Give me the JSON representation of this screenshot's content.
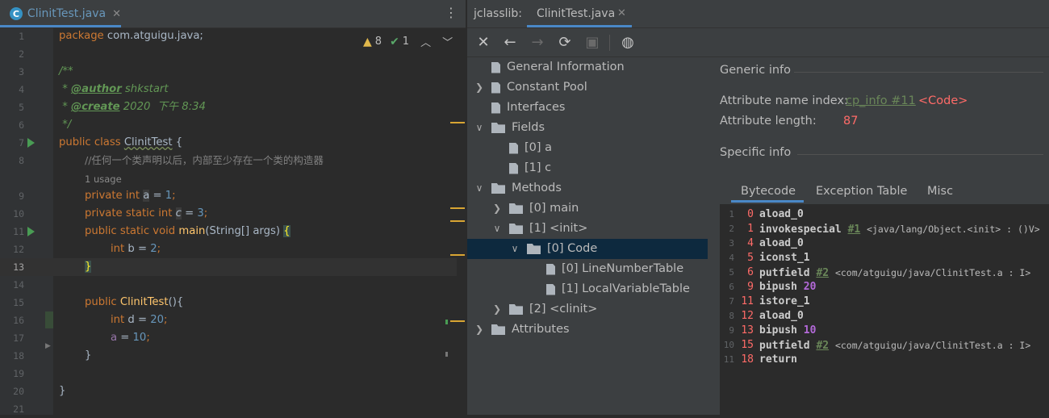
{
  "editor": {
    "tab_label": "ClinitTest.java",
    "tab_icon_letter": "C",
    "warnings_count": "8",
    "ok_count": "1",
    "line_numbers": [
      "1",
      "2",
      "3",
      "4",
      "5",
      "6",
      "7",
      "8",
      "9",
      "10",
      "11",
      "12",
      "13",
      "14",
      "15",
      "16",
      "17",
      "18",
      "19",
      "20",
      "21"
    ],
    "code": {
      "l1_pkg": "package",
      "l1_rest": " com.atguigu.java;",
      "l3": "/**",
      "l4_star": " * ",
      "l4_tag": "@author",
      "l4_val": " shkstart",
      "l5_star": " * ",
      "l5_tag": "@create",
      "l5_val": " 2020  下午 8:34",
      "l6": " */",
      "l7_kw": "public class",
      "l7_name": "ClinitTest",
      "l7_brace": " {",
      "l8": "//任何一个类声明以后，内部至少存在一个类的构造器",
      "usage": "1 usage",
      "l9_kw": "private int",
      "l9_var": "a",
      "l9_eq": " = ",
      "l9_val": "1",
      "l10_kw": "private static int",
      "l10_var": "c",
      "l10_eq": " = ",
      "l10_val": "3",
      "l11_kw": "public static void",
      "l11_fn": "main",
      "l11_args": "(String[] args) ",
      "l11_brace": "{",
      "l12_kw": "int",
      "l12_rest": " b = ",
      "l12_val": "2",
      "l13_brace": "}",
      "l15_kw": "public",
      "l15_fn": "ClinitTest",
      "l15_rest": "(){",
      "l16_kw": "int",
      "l16_rest": " d = ",
      "l16_val": "20",
      "l17_fld": "a",
      "l17_rest": " = ",
      "l17_val": "10",
      "l18": "}",
      "l20": "}",
      "semi": ";"
    }
  },
  "jclasslib": {
    "title": "jclasslib:",
    "tab_label": "ClinitTest.java",
    "toolbar": [
      "close-icon",
      "back-arrow-icon",
      "forward-arrow-icon",
      "refresh-icon",
      "save-icon",
      "web-icon"
    ],
    "tree": {
      "general": "General Information",
      "constant_pool": "Constant Pool",
      "interfaces": "Interfaces",
      "fields": "Fields",
      "field_a": "[0] a",
      "field_c": "[1] c",
      "methods": "Methods",
      "method_main": "[0] main",
      "method_init": "[1] <init>",
      "code": "[0] Code",
      "lnt": "[0] LineNumberTable",
      "lvt": "[1] LocalVariableTable",
      "method_clinit": "[2] <clinit>",
      "attributes": "Attributes"
    },
    "detail": {
      "generic_title": "Generic info",
      "attr_name_label": "Attribute name index:",
      "attr_name_link": "cp_info #11",
      "attr_name_value": "<Code>",
      "attr_len_label": "Attribute length:",
      "attr_len_value": "87",
      "specific_title": "Specific info",
      "tabs": [
        "Bytecode",
        "Exception Table",
        "Misc"
      ]
    },
    "bytecode": [
      {
        "ln": "1",
        "off": "0",
        "op": "aload_0",
        "ref": "",
        "arg": "",
        "cmt": ""
      },
      {
        "ln": "2",
        "off": "1",
        "op": "invokespecial",
        "ref": "#1",
        "arg": "",
        "cmt": "<java/lang/Object.<init> : ()V>"
      },
      {
        "ln": "3",
        "off": "4",
        "op": "aload_0",
        "ref": "",
        "arg": "",
        "cmt": ""
      },
      {
        "ln": "4",
        "off": "5",
        "op": "iconst_1",
        "ref": "",
        "arg": "",
        "cmt": ""
      },
      {
        "ln": "5",
        "off": "6",
        "op": "putfield",
        "ref": "#2",
        "arg": "",
        "cmt": "<com/atguigu/java/ClinitTest.a : I>"
      },
      {
        "ln": "6",
        "off": "9",
        "op": "bipush",
        "ref": "",
        "arg": "20",
        "cmt": ""
      },
      {
        "ln": "7",
        "off": "11",
        "op": "istore_1",
        "ref": "",
        "arg": "",
        "cmt": ""
      },
      {
        "ln": "8",
        "off": "12",
        "op": "aload_0",
        "ref": "",
        "arg": "",
        "cmt": ""
      },
      {
        "ln": "9",
        "off": "13",
        "op": "bipush",
        "ref": "",
        "arg": "10",
        "cmt": ""
      },
      {
        "ln": "10",
        "off": "15",
        "op": "putfield",
        "ref": "#2",
        "arg": "",
        "cmt": "<com/atguigu/java/ClinitTest.a : I>"
      },
      {
        "ln": "11",
        "off": "18",
        "op": "return",
        "ref": "",
        "arg": "",
        "cmt": ""
      }
    ]
  }
}
